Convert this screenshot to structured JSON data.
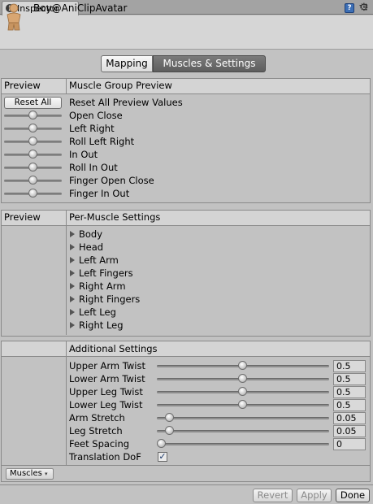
{
  "window": {
    "tab_label": "Inspector",
    "tab_icon": "info-icon",
    "lock_icon": "lock-icon",
    "menu_icon": "context-menu-icon"
  },
  "header": {
    "object_name": "Boy@AniClipAvatar",
    "avatar_icon": "avatar-figure-icon",
    "help_icon": "help-book-icon",
    "settings_icon": "gear-icon"
  },
  "toolbar": {
    "mapping_label": "Mapping",
    "muscles_label": "Muscles & Settings",
    "active": "Muscles & Settings"
  },
  "muscle_group": {
    "preview_header": "Preview",
    "title": "Muscle Group Preview",
    "reset_button": "Reset All",
    "reset_label": "Reset All Preview Values",
    "rows": [
      {
        "label": "Open Close",
        "level": 0.5
      },
      {
        "label": "Left Right",
        "level": 0.5
      },
      {
        "label": "Roll Left Right",
        "level": 0.5
      },
      {
        "label": "In Out",
        "level": 0.5
      },
      {
        "label": "Roll In Out",
        "level": 0.5
      },
      {
        "label": "Finger Open Close",
        "level": 0.5
      },
      {
        "label": "Finger In Out",
        "level": 0.5
      }
    ]
  },
  "per_muscle": {
    "preview_header": "Preview",
    "title": "Per-Muscle Settings",
    "items": [
      "Body",
      "Head",
      "Left Arm",
      "Left Fingers",
      "Right Arm",
      "Right Fingers",
      "Left Leg",
      "Right Leg"
    ]
  },
  "additional": {
    "title": "Additional Settings",
    "rows": [
      {
        "label": "Upper Arm Twist",
        "value": "0.5",
        "level": 0.5
      },
      {
        "label": "Lower Arm Twist",
        "value": "0.5",
        "level": 0.5
      },
      {
        "label": "Upper Leg Twist",
        "value": "0.5",
        "level": 0.5
      },
      {
        "label": "Lower Leg Twist",
        "value": "0.5",
        "level": 0.5
      },
      {
        "label": "Arm Stretch",
        "value": "0.05",
        "level": 0.05
      },
      {
        "label": "Leg Stretch",
        "value": "0.05",
        "level": 0.05
      },
      {
        "label": "Feet Spacing",
        "value": "0",
        "level": 0
      }
    ],
    "translation_label": "Translation DoF",
    "translation_checked": true,
    "muscles_dropdown": "Muscles"
  },
  "footer": {
    "revert_label": "Revert",
    "apply_label": "Apply",
    "done_label": "Done"
  }
}
